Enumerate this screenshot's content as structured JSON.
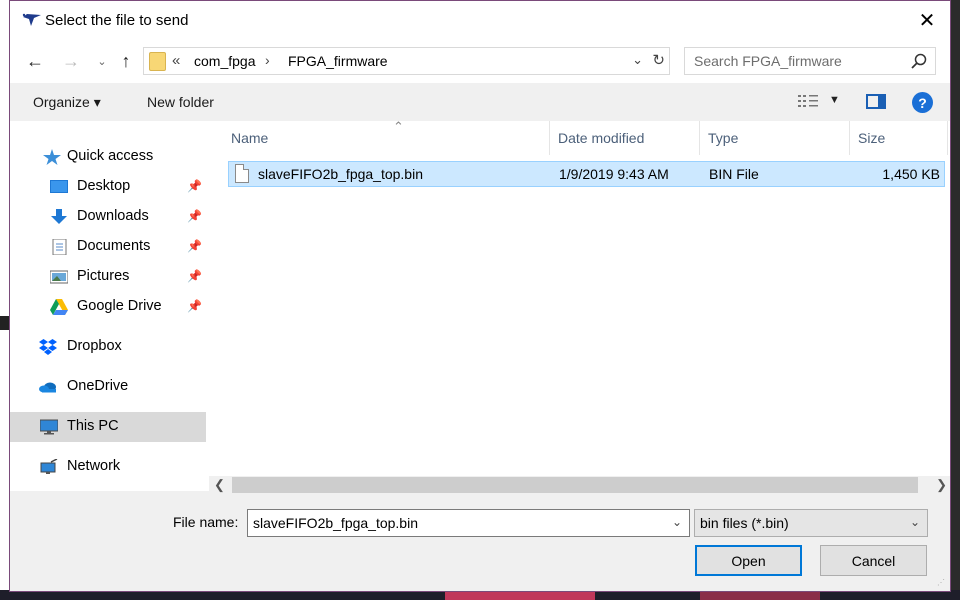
{
  "window": {
    "title": "Select the file to send"
  },
  "address": {
    "segments": [
      "com_fpga",
      "FPGA_firmware"
    ],
    "overflow": "«",
    "separator": "›"
  },
  "search": {
    "placeholder": "Search FPGA_firmware"
  },
  "toolbar": {
    "organize_label": "Organize ▾",
    "new_folder_label": "New folder"
  },
  "nav": {
    "items": [
      {
        "label": "Quick access",
        "icon": "star-icon"
      },
      {
        "label": "Desktop",
        "icon": "desktop-icon",
        "pinned": true
      },
      {
        "label": "Downloads",
        "icon": "download-arrow-icon",
        "pinned": true
      },
      {
        "label": "Documents",
        "icon": "document-icon",
        "pinned": true
      },
      {
        "label": "Pictures",
        "icon": "picture-icon",
        "pinned": true
      },
      {
        "label": "Google Drive",
        "icon": "google-drive-icon",
        "pinned": true
      },
      {
        "label": "Dropbox",
        "icon": "dropbox-icon"
      },
      {
        "label": "OneDrive",
        "icon": "cloud-icon"
      },
      {
        "label": "This PC",
        "icon": "monitor-icon",
        "selected": true
      },
      {
        "label": "Network",
        "icon": "network-icon"
      }
    ]
  },
  "columns": [
    "Name",
    "Date modified",
    "Type",
    "Size"
  ],
  "files": [
    {
      "name": "slaveFIFO2b_fpga_top.bin",
      "date": "1/9/2019 9:43 AM",
      "type": "BIN File",
      "size": "1,450 KB",
      "selected": true
    }
  ],
  "bottom": {
    "file_name_label": "File name:",
    "file_name_value": "slaveFIFO2b_fpga_top.bin",
    "file_type_value": "bin files (*.bin)",
    "open_label": "Open",
    "cancel_label": "Cancel"
  },
  "colors": {
    "selection": "#cce8ff",
    "accent": "#0078d7",
    "nav_selected": "#d9d9d9"
  }
}
